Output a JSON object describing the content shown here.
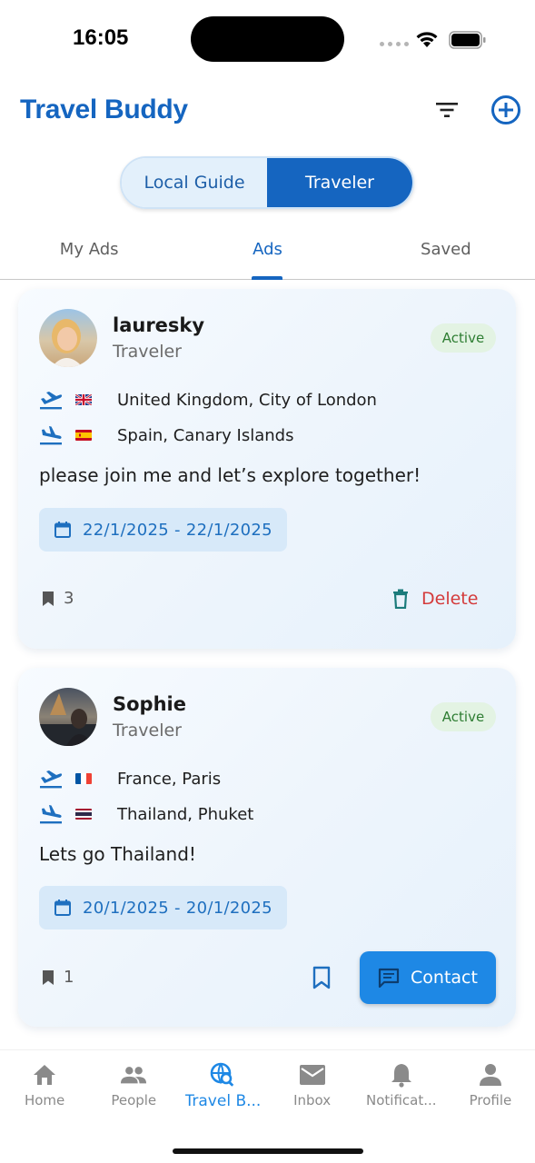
{
  "status_bar": {
    "time": "16:05"
  },
  "header": {
    "title": "Travel Buddy",
    "filter_icon": "filter-icon",
    "add_icon": "add-circle-icon"
  },
  "segmented": {
    "options": [
      "Local Guide",
      "Traveler"
    ],
    "selected": "Traveler"
  },
  "tabs": [
    {
      "label": "My Ads",
      "active": false
    },
    {
      "label": "Ads",
      "active": true
    },
    {
      "label": "Saved",
      "active": false
    }
  ],
  "ads": [
    {
      "name": "lauresky",
      "role": "Traveler",
      "status": "Active",
      "from": {
        "place": "United Kingdom, City of London",
        "flag": "uk-flag-icon"
      },
      "to": {
        "place": "Spain, Canary Islands",
        "flag": "spain-flag-icon"
      },
      "message": "please join me and let’s explore together!",
      "dates": "22/1/2025 - 22/1/2025",
      "save_count": "3",
      "action_label": "Delete"
    },
    {
      "name": "Sophie",
      "role": "Traveler",
      "status": "Active",
      "from": {
        "place": "France, Paris",
        "flag": "france-flag-icon"
      },
      "to": {
        "place": "Thailand, Phuket",
        "flag": "thailand-flag-icon"
      },
      "message": "Lets go Thailand!",
      "dates": "20/1/2025 - 20/1/2025",
      "save_count": "1",
      "action_label": "Contact"
    }
  ],
  "bottom_nav": [
    {
      "label": "Home",
      "icon": "home-icon",
      "active": false
    },
    {
      "label": "People",
      "icon": "people-icon",
      "active": false
    },
    {
      "label": "Travel B...",
      "icon": "travel-search-icon",
      "active": true
    },
    {
      "label": "Inbox",
      "icon": "mail-icon",
      "active": false
    },
    {
      "label": "Notificat...",
      "icon": "bell-icon",
      "active": false
    },
    {
      "label": "Profile",
      "icon": "person-icon",
      "active": false
    }
  ],
  "colors": {
    "brand": "#1565c0",
    "accent": "#1e88e5",
    "active_green": "#2e7d32",
    "delete_red": "#d43b3b"
  }
}
